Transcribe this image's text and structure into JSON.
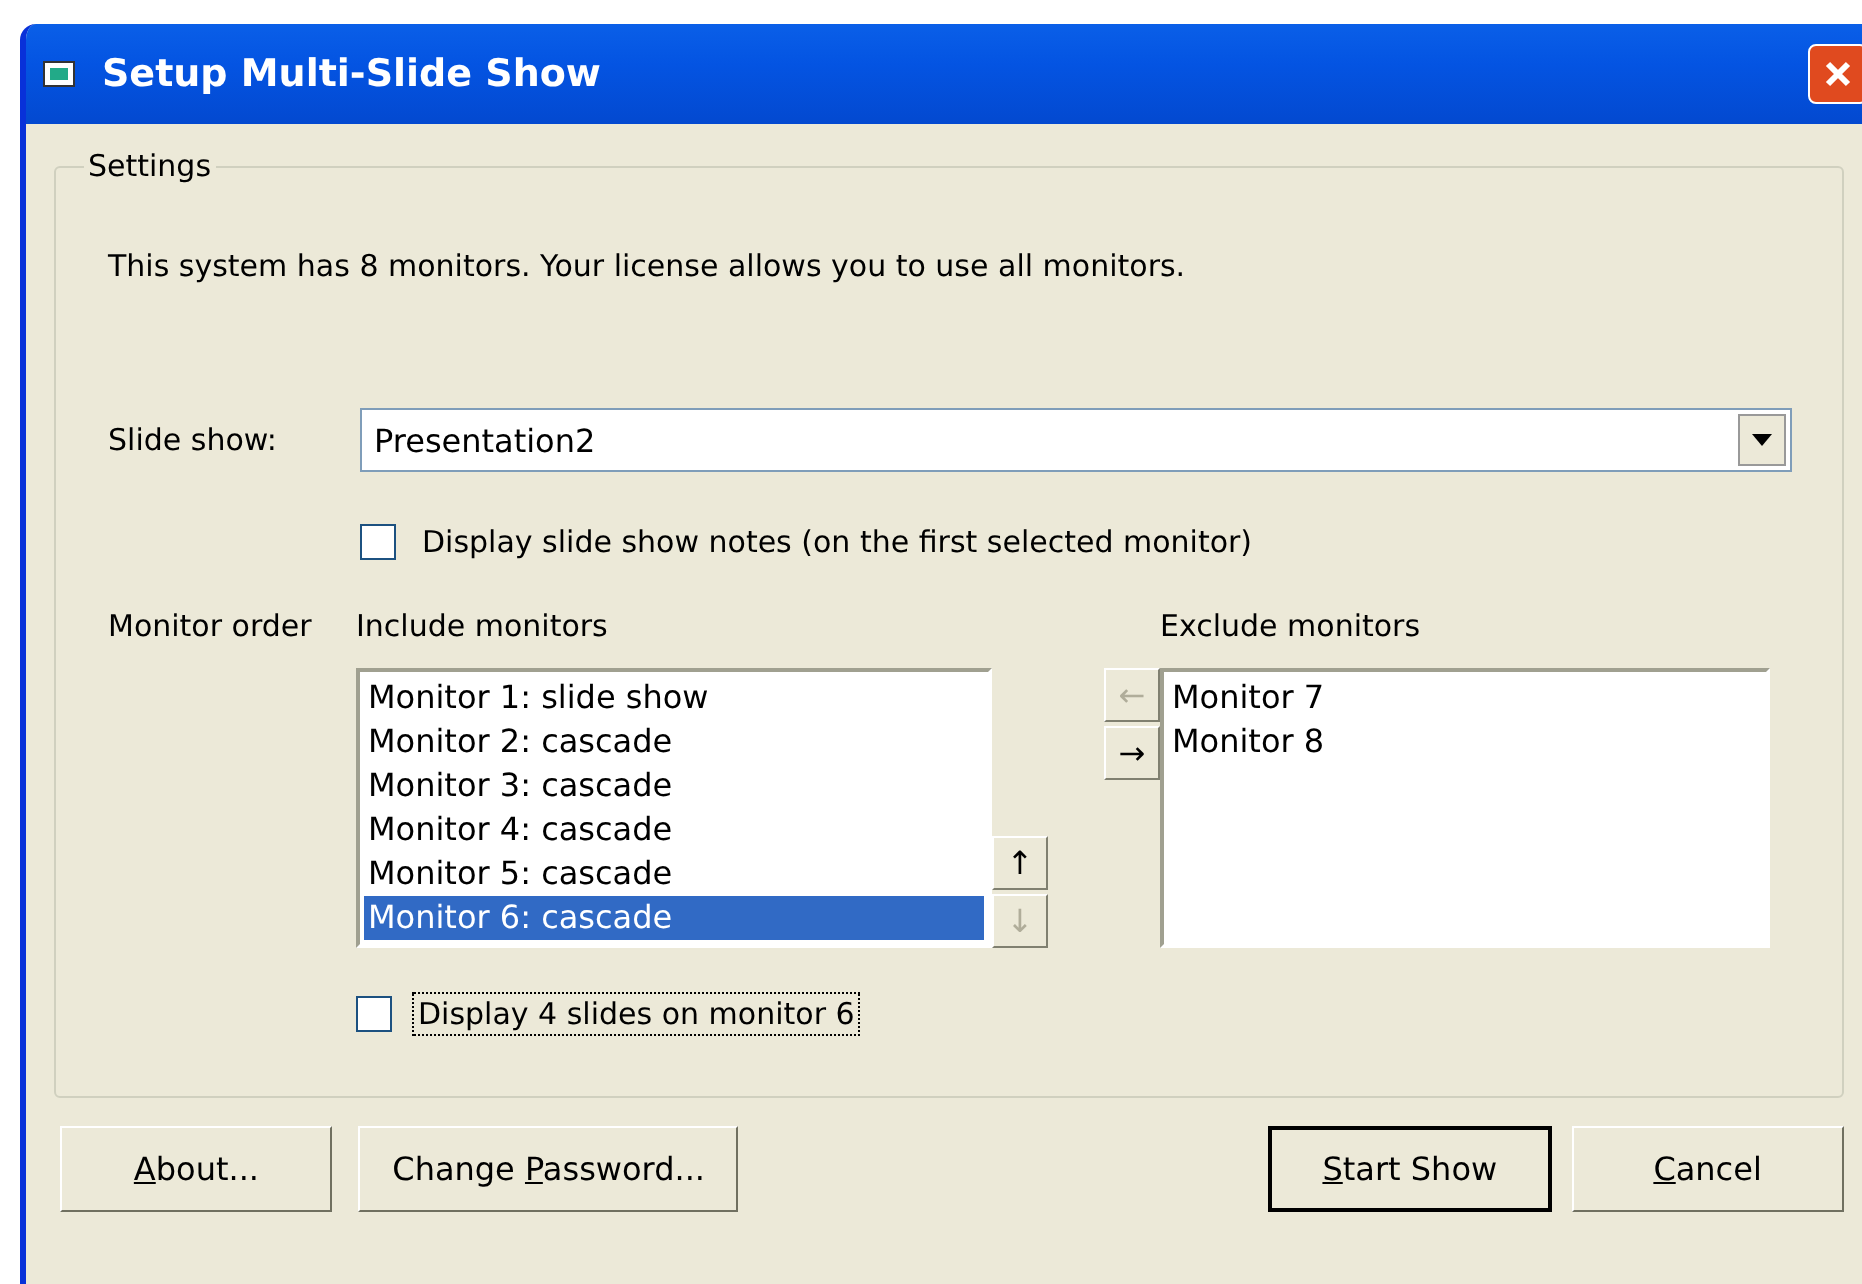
{
  "window": {
    "title": "Setup Multi-Slide Show"
  },
  "settings": {
    "legend": "Settings",
    "info": "This system has 8 monitors. Your license allows you to use all monitors.",
    "slide_show": {
      "label": "Slide show:",
      "value": "Presentation2"
    },
    "notes_checkbox": {
      "label": "Display slide show notes (on the first selected monitor)",
      "checked": false
    },
    "monitor_order": {
      "label": "Monitor order",
      "include_label": "Include monitors",
      "exclude_label": "Exclude monitors",
      "include": [
        {
          "text": "Monitor 1: slide show",
          "selected": false
        },
        {
          "text": "Monitor 2: cascade",
          "selected": false
        },
        {
          "text": "Monitor 3: cascade",
          "selected": false
        },
        {
          "text": "Monitor 4: cascade",
          "selected": false
        },
        {
          "text": "Monitor 5: cascade",
          "selected": false
        },
        {
          "text": "Monitor 6: cascade",
          "selected": true
        }
      ],
      "exclude": [
        {
          "text": "Monitor 7",
          "selected": false
        },
        {
          "text": "Monitor 8",
          "selected": false
        }
      ],
      "move_buttons": [
        {
          "glyph": "←",
          "disabled": true
        },
        {
          "glyph": "→",
          "disabled": false
        }
      ],
      "order_buttons": [
        {
          "glyph": "↑",
          "disabled": false
        },
        {
          "glyph": "↓",
          "disabled": true
        }
      ]
    },
    "slides_checkbox": {
      "label": "Display 4 slides on monitor 6",
      "checked": false,
      "focused": true
    }
  },
  "buttons": [
    {
      "key": "A",
      "after": "bout...",
      "default": false
    },
    {
      "before": "Change ",
      "key": "P",
      "after": "assword...",
      "default": false
    },
    {
      "key": "S",
      "after": "tart Show",
      "default": true
    },
    {
      "key": "C",
      "after": "ancel",
      "default": false
    }
  ]
}
